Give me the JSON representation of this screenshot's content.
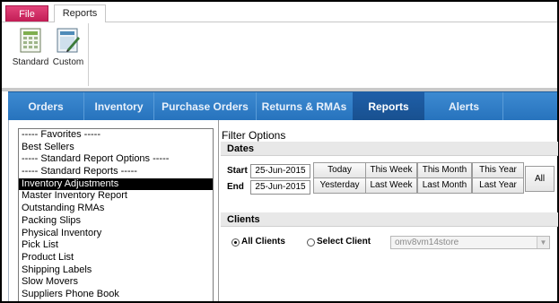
{
  "ribbon": {
    "tabs": [
      {
        "label": "File"
      },
      {
        "label": "Reports"
      }
    ],
    "buttons": [
      {
        "label": "Standard",
        "icon": "standard-report-icon"
      },
      {
        "label": "Custom",
        "icon": "custom-report-icon"
      }
    ]
  },
  "nav": {
    "items": [
      {
        "label": "Orders"
      },
      {
        "label": "Inventory"
      },
      {
        "label": "Purchase Orders"
      },
      {
        "label": "Returns & RMAs"
      },
      {
        "label": "Reports"
      },
      {
        "label": "Alerts"
      }
    ],
    "active": "Reports"
  },
  "report_list": {
    "items": [
      {
        "label": "-----  Favorites  -----"
      },
      {
        "label": "Best Sellers"
      },
      {
        "label": "-----  Standard Report Options  -----"
      },
      {
        "label": "-----  Standard Reports  -----"
      },
      {
        "label": "Inventory Adjustments"
      },
      {
        "label": "Master Inventory Report"
      },
      {
        "label": "Outstanding RMAs"
      },
      {
        "label": "Packing Slips"
      },
      {
        "label": "Physical Inventory"
      },
      {
        "label": "Pick List"
      },
      {
        "label": "Product List"
      },
      {
        "label": "Shipping Labels"
      },
      {
        "label": "Slow Movers"
      },
      {
        "label": "Suppliers Phone Book"
      }
    ],
    "selected": "Inventory Adjustments"
  },
  "filter": {
    "title": "Filter Options",
    "dates": {
      "header": "Dates",
      "start_label": "Start",
      "start_value": "25-Jun-2015",
      "end_label": "End",
      "end_value": "25-Jun-2015",
      "buttons": {
        "today": "Today",
        "yesterday": "Yesterday",
        "this_week": "This Week",
        "last_week": "Last Week",
        "this_month": "This Month",
        "last_month": "Last Month",
        "this_year": "This Year",
        "last_year": "Last Year",
        "all": "All"
      }
    },
    "clients": {
      "header": "Clients",
      "all_clients_label": "All Clients",
      "select_client_label": "Select Client",
      "selected_option": "All Clients",
      "client_value": "omv8vm14store"
    }
  },
  "colors": {
    "nav_bg": "#2773bd",
    "nav_active": "#18508f",
    "file_tab": "#c21d55",
    "selection": "#000000"
  }
}
